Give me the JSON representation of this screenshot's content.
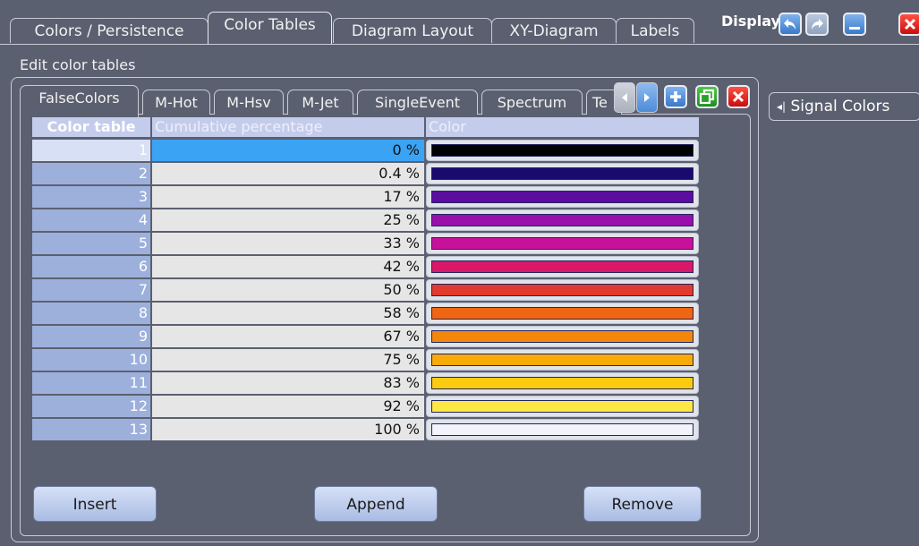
{
  "top_tabs": [
    {
      "label": "Colors / Persistence"
    },
    {
      "label": "Color Tables"
    },
    {
      "label": "Diagram Layout"
    },
    {
      "label": "XY-Diagram"
    },
    {
      "label": "Labels"
    }
  ],
  "display": {
    "label": "Display"
  },
  "section": {
    "label": "Edit color tables"
  },
  "inner_tabs": [
    {
      "label": "FalseColors"
    },
    {
      "label": "M-Hot"
    },
    {
      "label": "M-Hsv"
    },
    {
      "label": "M-Jet"
    },
    {
      "label": "SingleEvent"
    },
    {
      "label": "Spectrum"
    },
    {
      "label": "Te"
    }
  ],
  "table": {
    "headers": {
      "color_table": "Color table",
      "cumulative": "Cumulative percentage",
      "color": "Color"
    },
    "rows": [
      {
        "index": "1",
        "percent": "0 %",
        "color": "#000000"
      },
      {
        "index": "2",
        "percent": "0.4 %",
        "color": "#1a0a70"
      },
      {
        "index": "3",
        "percent": "17 %",
        "color": "#5c0d9e"
      },
      {
        "index": "4",
        "percent": "25 %",
        "color": "#9a0fac"
      },
      {
        "index": "5",
        "percent": "33 %",
        "color": "#c8119b"
      },
      {
        "index": "6",
        "percent": "42 %",
        "color": "#d9186a"
      },
      {
        "index": "7",
        "percent": "50 %",
        "color": "#e23a2c"
      },
      {
        "index": "8",
        "percent": "58 %",
        "color": "#ee6512"
      },
      {
        "index": "9",
        "percent": "67 %",
        "color": "#f3870b"
      },
      {
        "index": "10",
        "percent": "75 %",
        "color": "#f8aa08"
      },
      {
        "index": "11",
        "percent": "83 %",
        "color": "#fccb10"
      },
      {
        "index": "12",
        "percent": "92 %",
        "color": "#fee844"
      },
      {
        "index": "13",
        "percent": "100 %",
        "color": "#f2f3fb"
      }
    ]
  },
  "buttons": {
    "insert": "Insert",
    "append": "Append",
    "remove": "Remove"
  },
  "side": {
    "label": "Signal Colors"
  }
}
